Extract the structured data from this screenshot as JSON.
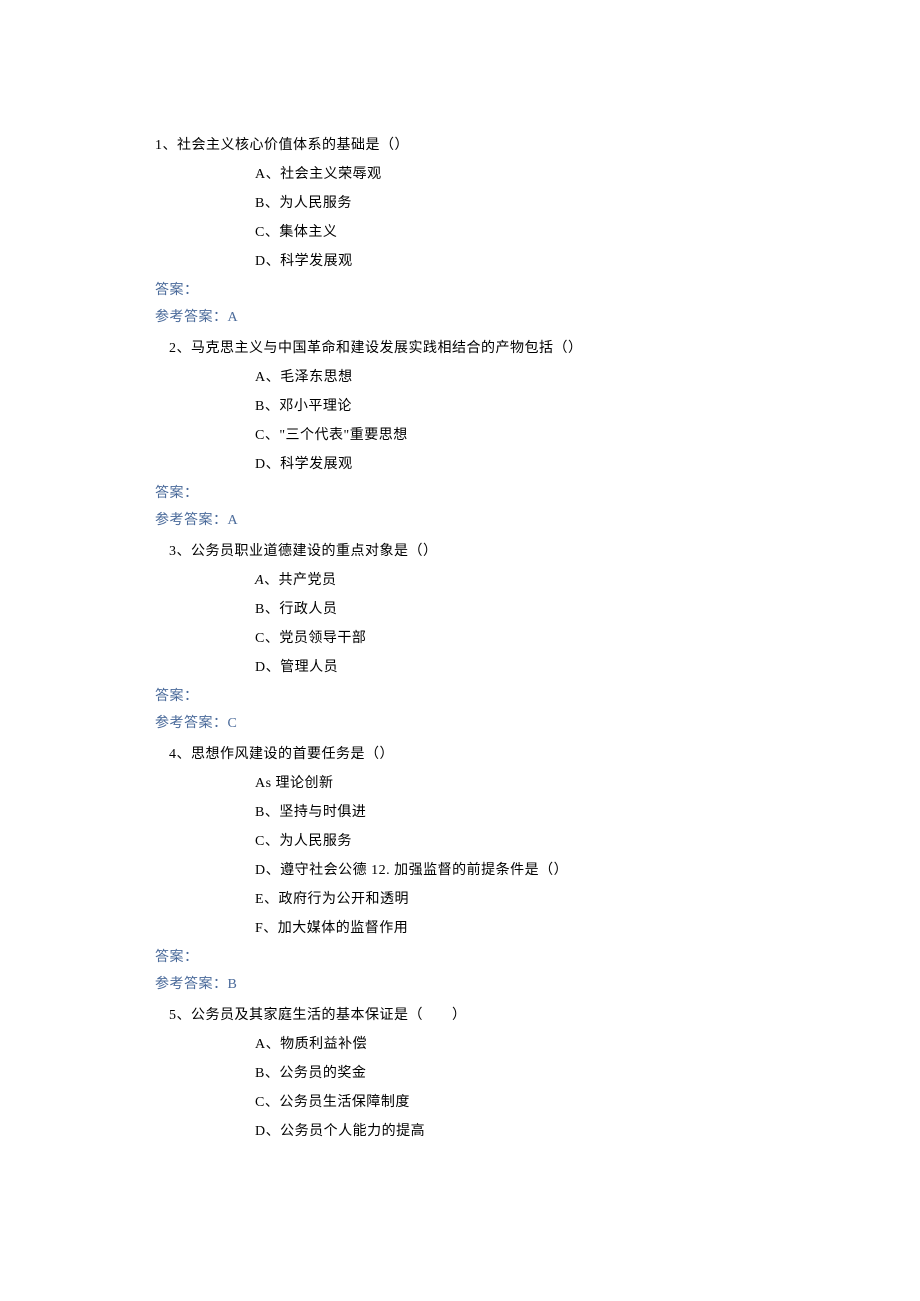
{
  "labels": {
    "answer": "答案：",
    "reference_prefix": "参考答案："
  },
  "questions": [
    {
      "number": "1、",
      "text": "社会主义核心价值体系的基础是（）",
      "options": [
        "A、社会主义荣辱观",
        "B、为人民服务",
        "C、集体主义",
        "D、科学发展观"
      ],
      "answer": "A"
    },
    {
      "number": "2、",
      "text": "马克思主义与中国革命和建设发展实践相结合的产物包括（）",
      "options": [
        "A、毛泽东思想",
        "B、邓小平理论",
        "C、\"三个代表\"重要思想",
        "D、科学发展观"
      ],
      "answer": "A"
    },
    {
      "number": "3、",
      "text": "公务员职业道德建设的重点对象是（）",
      "options": [
        "A、共产党员",
        "B、行政人员",
        "C、党员领导干部",
        "D、管理人员"
      ],
      "answer": "C",
      "option_a_italic": true
    },
    {
      "number": "4、",
      "text": "思想作风建设的首要任务是（）",
      "options": [
        "As 理论创新",
        "B、坚持与时俱进",
        "C、为人民服务",
        "D、遵守社会公德 12. 加强监督的前提条件是（）",
        "E、政府行为公开和透明",
        "F、加大媒体的监督作用"
      ],
      "answer": "B"
    },
    {
      "number": "5、",
      "text": "公务员及其家庭生活的基本保证是（　　）",
      "options": [
        "A、物质利益补偿",
        "B、公务员的奖金",
        "C、公务员生活保障制度",
        "D、公务员个人能力的提高"
      ],
      "answer": null
    }
  ]
}
